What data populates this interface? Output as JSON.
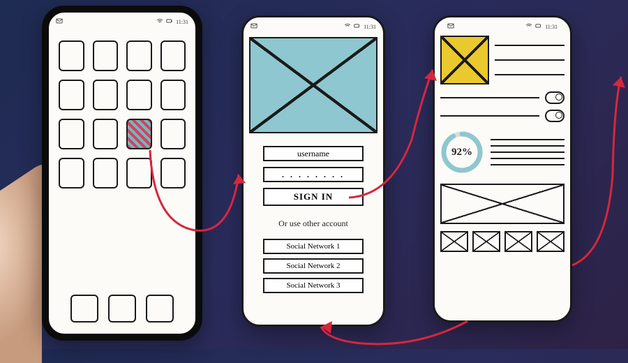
{
  "statusbar": {
    "time": "11:31",
    "icons_left": [
      "mail-icon"
    ],
    "icons_right": [
      "wifi-icon",
      "battery-icon",
      "signal-icon",
      "clock-text"
    ]
  },
  "phone1": {
    "name": "home-screen",
    "grid_rows": 4,
    "grid_cols": 4,
    "active_index": 10,
    "dock_count": 3
  },
  "phone2": {
    "name": "login-screen",
    "username_label": "username",
    "password_mask": ". . . . . . . .",
    "signin_label": "SIGN IN",
    "alt_label": "Or use other account",
    "social": [
      "Social Network 1",
      "Social Network 2",
      "Social Network 3"
    ]
  },
  "phone3": {
    "name": "dashboard-screen",
    "headline_lines": 3,
    "toggle_count": 2,
    "gauge_value": "92%",
    "gauge_fraction": 0.92,
    "paragraph_lines": 5,
    "nav_count": 4
  },
  "flows": [
    {
      "from": "phone1.active_app",
      "to": "phone2.hero"
    },
    {
      "from": "phone2.signin",
      "to": "phone3.top"
    },
    {
      "from": "phone3.navbar",
      "to": "phone2.bottom"
    },
    {
      "from": "phone3.bigimg",
      "to": "offscreen-right"
    }
  ],
  "colors": {
    "bg_start": "#1e2b52",
    "bg_end": "#2d2246",
    "ink": "#1a1a1a",
    "paper": "#fcfbf8",
    "hero": "#8ec7cf",
    "thumb": "#e9c92e",
    "arrow": "#d7263d"
  }
}
